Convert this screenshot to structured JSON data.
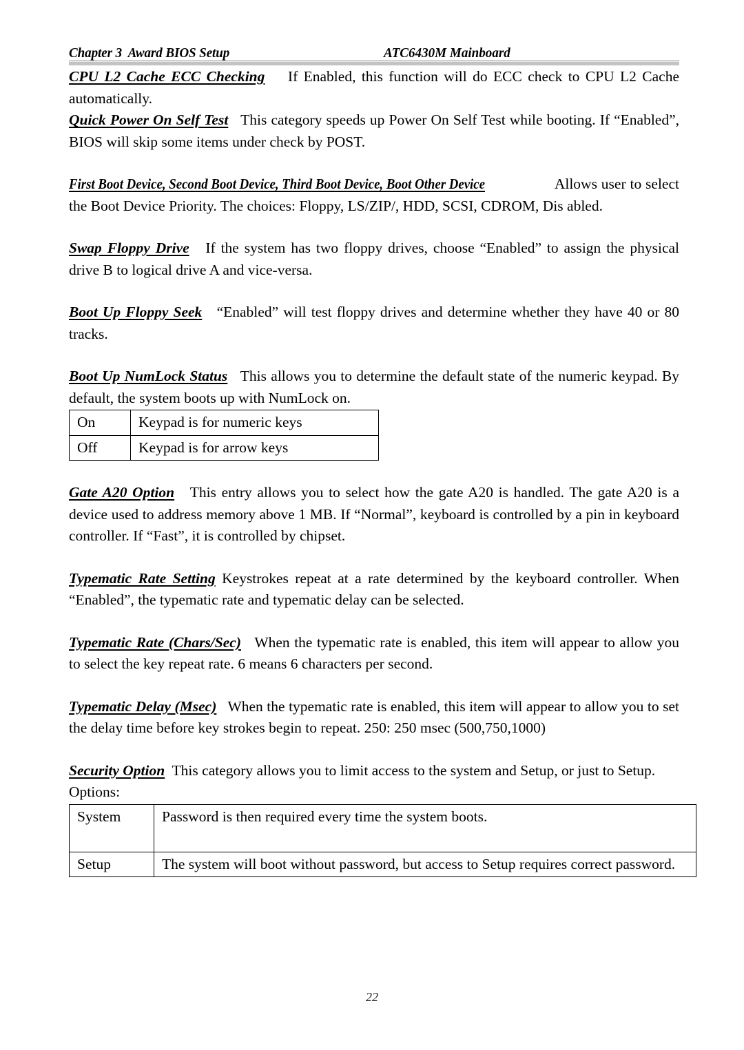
{
  "document": {
    "header": {
      "left": "Chapter 3  Award BIOS Setup",
      "right": "ATC6430M Mainboard"
    },
    "page_number": "22"
  },
  "entries": [
    {
      "term": "CPU L2 Cache ECC Checking",
      "description": "If Enabled, this function will do ECC check to CPU L2 Cache automatically."
    },
    {
      "term": "Quick Power On Self Test",
      "description": "This category speeds up Power On Self Test while booting. If “Enabled”, BIOS will skip some items under check by POST."
    },
    {
      "term": "First Boot Device, Second Boot Device, Third Boot Device, Boot Other Device",
      "description": "Allows user to select the Boot Device Priority.  The choices: Floppy, LS/ZIP/, HDD, SCSI, CDROM, Dis abled."
    },
    {
      "term": "Swap Floppy Drive",
      "description": "If the system has two floppy drives, choose “Enabled” to assign the physical drive B to logical drive A and vice-versa."
    },
    {
      "term": "Boot Up Floppy Seek",
      "description": "“Enabled” will test floppy drives and determine whether they have 40 or 80 tracks."
    },
    {
      "term": "Boot Up NumLock Status",
      "description": "This allows you to determine the default state of the numeric keypad. By default, the system boots up with NumLock on."
    },
    {
      "term": "Gate A20 Option",
      "description": "This entry allows you to select how the gate A20 is handled. The gate A20 is a device used to address memory above 1 MB. If “Normal”,  keyboard is controlled by a pin in keyboard controller. If “Fast”, it is controlled by chipset."
    },
    {
      "term": "Typematic Rate Setting",
      "description": "Keystrokes repeat at a rate determined by the keyboard controller.   When “Enabled”, the typematic rate and typematic delay can be selected."
    },
    {
      "term": "Typematic Rate (Chars/Sec)",
      "description": "When the typematic rate is enabled, this item will appear to allow you to select the key repeat rate. 6 means 6 characters per second."
    },
    {
      "term": "Typematic Delay (Msec)",
      "description": "When the typematic rate is enabled, this item will appear to allow you to set the delay time before key strokes begin to repeat. 250: 250 msec (500,750,1000)"
    },
    {
      "term": "Security Option",
      "description": "This category allows you to limit access to the system and Setup, or just to Setup.    Options:"
    }
  ],
  "numlock_table": {
    "rows": [
      {
        "option": "On",
        "meaning": "Keypad is for numeric keys"
      },
      {
        "option": "Off",
        "meaning": "Keypad is for arrow keys"
      }
    ]
  },
  "security_table": {
    "rows": [
      {
        "option": "System",
        "meaning": "Password is then required every time the system boots."
      },
      {
        "option": "Setup",
        "meaning": "The system will boot without password, but access to Setup requires correct password."
      }
    ]
  }
}
